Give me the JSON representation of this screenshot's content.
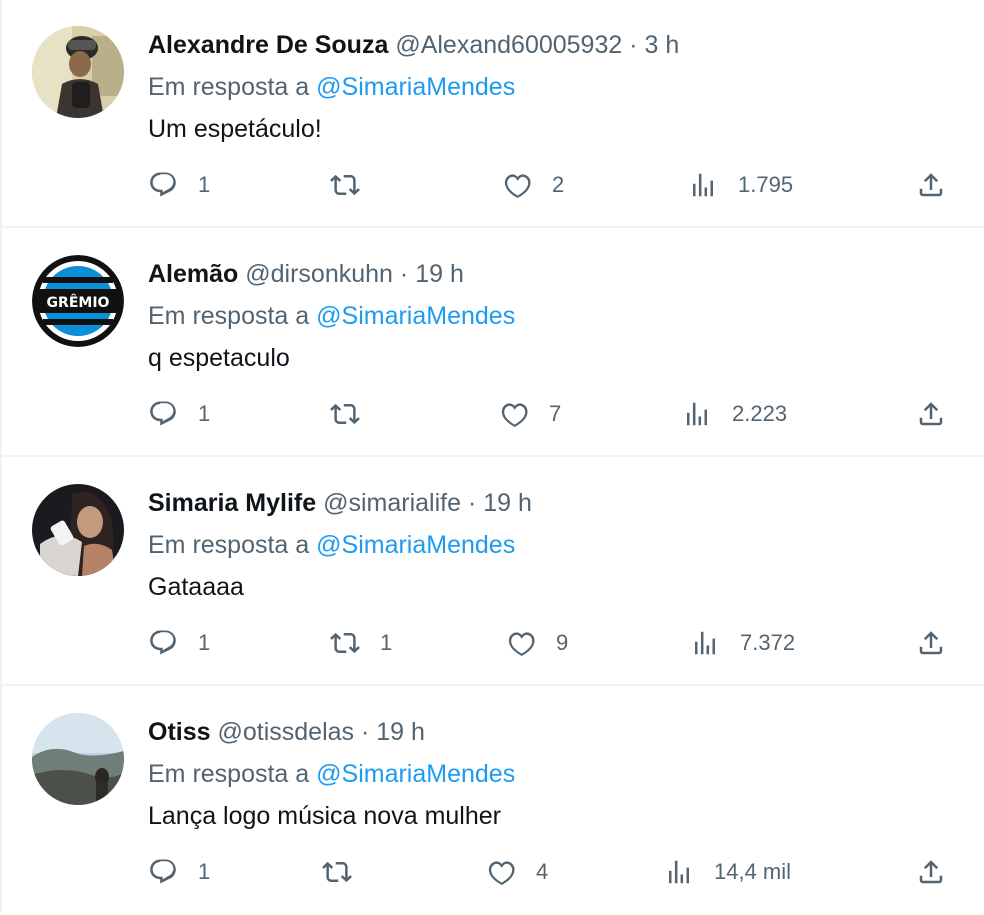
{
  "tweets": [
    {
      "name": "Alexandre De Souza",
      "handle": "@Alexand60005932",
      "sep": "·",
      "time": "3 h",
      "reply_prefix": "Em resposta a",
      "reply_to": "@SimariaMendes",
      "text": "Um espetáculo!",
      "replies": "1",
      "retweets": "",
      "likes": "2",
      "views": "1.795",
      "avatar": "photo-avatar"
    },
    {
      "name": "Alemão",
      "handle": "@dirsonkuhn",
      "sep": "·",
      "time": "19 h",
      "reply_prefix": "Em resposta a",
      "reply_to": "@SimariaMendes",
      "text": "q espetaculo",
      "replies": "1",
      "retweets": "",
      "likes": "7",
      "views": "2.223",
      "avatar": "gremio-logo-avatar",
      "avatar_text": "GRÊMIO"
    },
    {
      "name": "Simaria Mylife",
      "handle": "@simarialife",
      "sep": "·",
      "time": "19 h",
      "reply_prefix": "Em resposta a",
      "reply_to": "@SimariaMendes",
      "text": "Gataaaa",
      "replies": "1",
      "retweets": "1",
      "likes": "9",
      "views": "7.372",
      "avatar": "photo-avatar"
    },
    {
      "name": "Otiss",
      "handle": "@otissdelas",
      "sep": "·",
      "time": "19 h",
      "reply_prefix": "Em resposta a",
      "reply_to": "@SimariaMendes",
      "text": "Lança logo música nova mulher",
      "replies": "1",
      "retweets": "",
      "likes": "4",
      "views": "14,4 mil",
      "avatar": "landscape-photo-avatar"
    }
  ],
  "icons": {
    "reply": "reply-icon",
    "retweet": "retweet-icon",
    "like": "heart-icon",
    "views": "views-icon",
    "share": "share-icon"
  },
  "colors": {
    "accent": "#1d9bf0",
    "muted": "#536471",
    "text": "#0f1419",
    "divider": "#eff3f4"
  }
}
